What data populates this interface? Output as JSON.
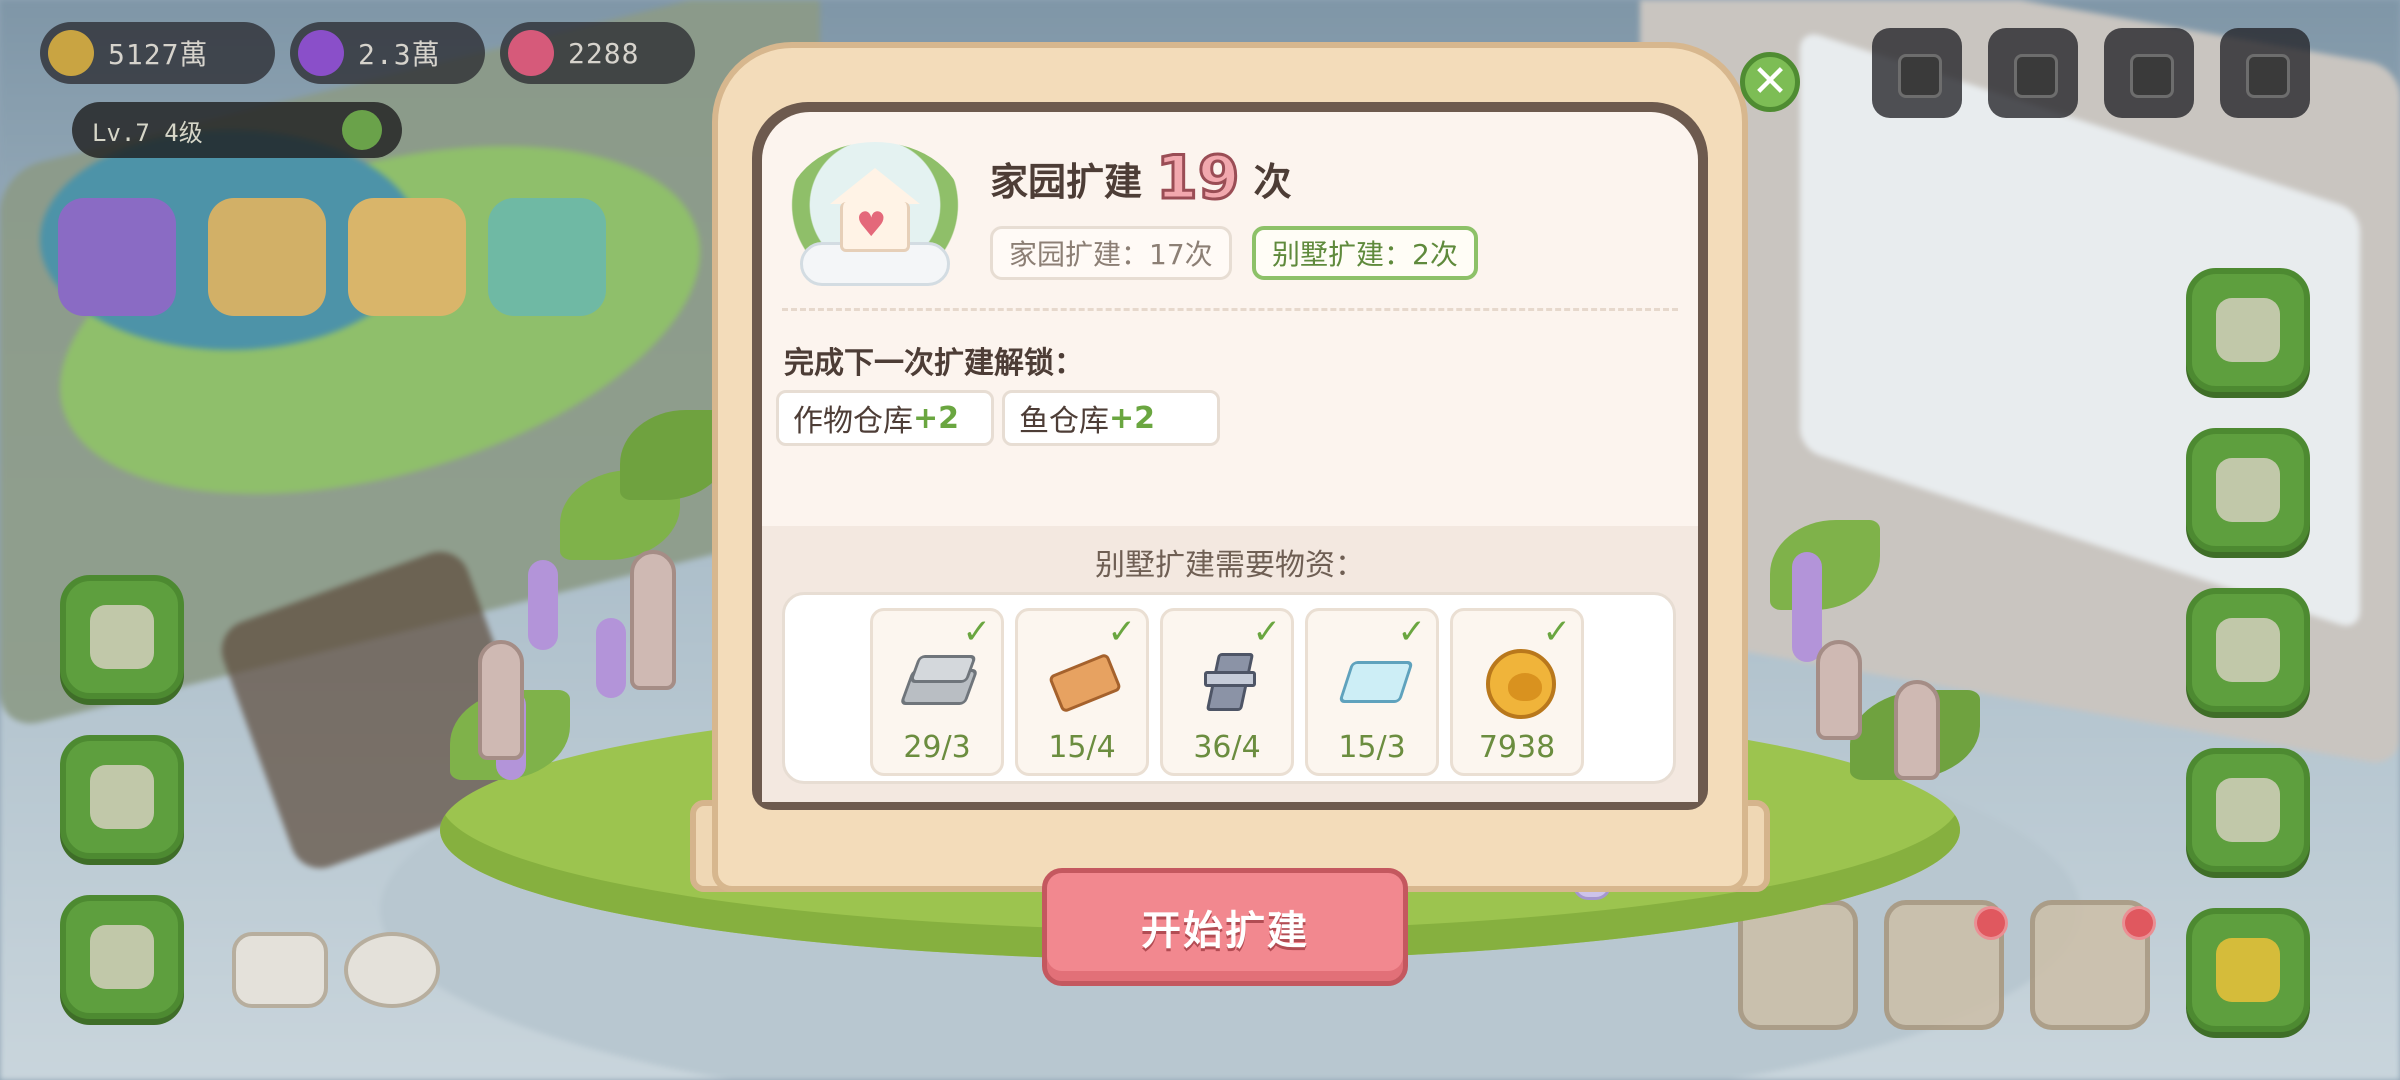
{
  "hud": {
    "coins": "5127萬",
    "gems": "2.3萬",
    "hearts": "2288",
    "level_text": "Lv.7 4级"
  },
  "colors": {
    "accent_pink": "#f2888f",
    "accent_green": "#6aa640",
    "frame_wood": "#f3dcba"
  },
  "dialog": {
    "title_prefix": "家园扩建",
    "count": "19",
    "title_suffix": "次",
    "chips": {
      "home": "家园扩建：17次",
      "villa": "别墅扩建：2次"
    },
    "unlock_title": "完成下一次扩建解锁：",
    "unlocks": [
      {
        "name": "作物仓库",
        "plus": "+2"
      },
      {
        "name": "鱼仓库",
        "plus": "+2"
      }
    ],
    "requirements_title": "别墅扩建需要物资：",
    "requirements": [
      {
        "icon": "steel-ingot-icon",
        "value": "29/3"
      },
      {
        "icon": "wood-plank-icon",
        "value": "15/4"
      },
      {
        "icon": "iron-beam-icon",
        "value": "36/4"
      },
      {
        "icon": "glass-pane-icon",
        "value": "15/3"
      },
      {
        "icon": "gold-coin-icon",
        "value": "7938"
      }
    ],
    "start_button": "开始扩建",
    "close_symbol": "✕",
    "check_symbol": "✓",
    "heart_symbol": "♥"
  }
}
